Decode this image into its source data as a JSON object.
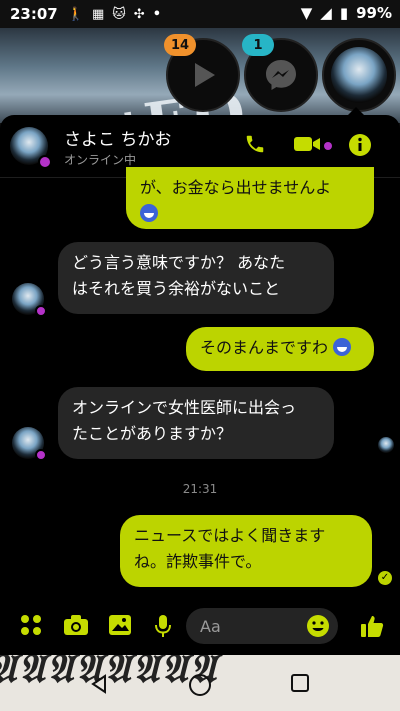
{
  "status": {
    "time": "23:07",
    "battery": "99%",
    "icons": [
      "walk-icon",
      "calendar-icon",
      "cat-icon",
      "fan-icon",
      "dot-icon"
    ]
  },
  "chat_heads": [
    {
      "badge": "14",
      "badge_color": "#f0912c",
      "icon": "play-icon"
    },
    {
      "badge": "1",
      "badge_color": "#27b5c6",
      "icon": "messenger-icon"
    },
    {
      "icon": "contact-avatar"
    }
  ],
  "header": {
    "name": "さよこ ちかお",
    "status": "オンライン中"
  },
  "messages": {
    "m1_line1": "が、お金なら出せませんよ",
    "m2_line1": "どう言う意味ですか？ あなた",
    "m2_line2": "はそれを買う余裕がないこと",
    "m3_line1": "そのまんまですわ",
    "m4_line1": "オンラインで女性医師に出会っ",
    "m4_line2": "たことがありますか？",
    "timestamp": "21:31",
    "m5_line1": "ニュースではよく聞きます",
    "m5_line2": "ね。詐欺事件で。"
  },
  "composer": {
    "placeholder": "Aa"
  },
  "colors": {
    "accent": "#bcd400",
    "online": "#b432c8"
  }
}
